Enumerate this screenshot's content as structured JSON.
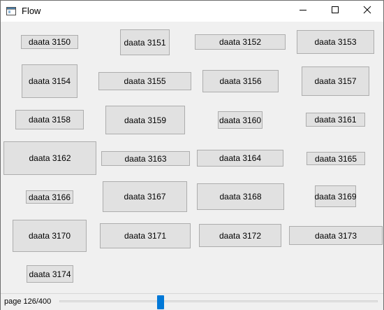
{
  "window": {
    "title": "Flow"
  },
  "items": [
    "daata 3150",
    "daata 3151",
    "daata 3152",
    "daata 3153",
    "daata 3154",
    "daata 3155",
    "daata 3156",
    "daata 3157",
    "daata 3158",
    "daata 3159",
    "daata 3160",
    "daata 3161",
    "daata 3162",
    "daata 3163",
    "daata 3164",
    "daata 3165",
    "daata 3166",
    "daata 3167",
    "daata 3168",
    "daata 3169",
    "daata 3170",
    "daata 3171",
    "daata 3172",
    "daata 3173",
    "daata 3174"
  ],
  "status": {
    "page_label": "page 126/400"
  },
  "slider": {
    "current": 126,
    "total": 400
  },
  "colors": {
    "accent": "#0078d7",
    "item_bg": "#e1e1e1",
    "item_border": "#adadad"
  },
  "icons": {
    "app": "window-app-icon",
    "minimize": "minimize-icon",
    "maximize": "maximize-icon",
    "close": "close-icon"
  }
}
